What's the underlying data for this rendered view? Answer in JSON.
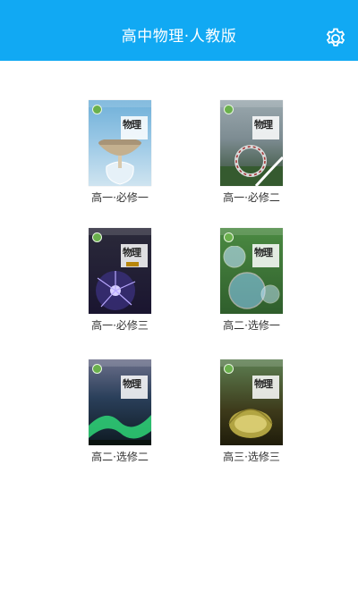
{
  "header": {
    "title": "高中物理·人教版",
    "settings_icon": "gear-icon"
  },
  "books": [
    {
      "label": "高一·必修一",
      "cover_title": "物理",
      "cover_colors": [
        "#7bb6d8",
        "#c9b79a"
      ]
    },
    {
      "label": "高一·必修二",
      "cover_title": "物理",
      "cover_colors": [
        "#8a9aa0",
        "#3f6b3a"
      ]
    },
    {
      "label": "高一·必修三",
      "cover_title": "物理",
      "cover_colors": [
        "#1a1230",
        "#8f86ff"
      ]
    },
    {
      "label": "高二·选修一",
      "cover_title": "物理",
      "cover_colors": [
        "#3e7a3a",
        "#a8d5ff"
      ]
    },
    {
      "label": "高二·选修二",
      "cover_title": "物理",
      "cover_colors": [
        "#203a52",
        "#3fe27a"
      ]
    },
    {
      "label": "高三·选修三",
      "cover_title": "物理",
      "cover_colors": [
        "#4a4520",
        "#c8b94a"
      ]
    }
  ],
  "colors": {
    "header_bg": "#11a9f3",
    "title_text": "#ffffff",
    "label_text": "#333333"
  }
}
